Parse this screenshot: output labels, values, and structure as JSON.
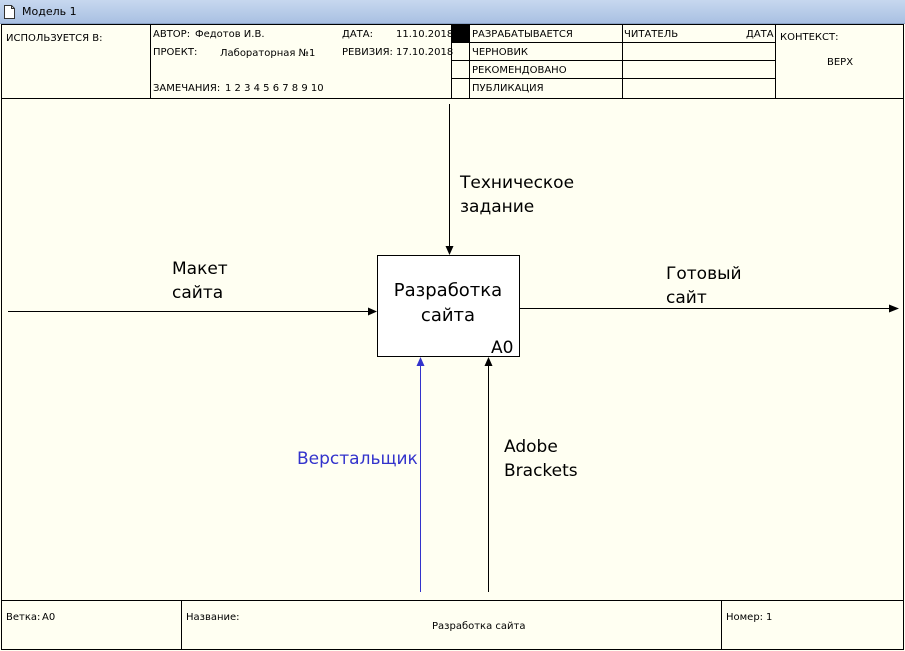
{
  "window": {
    "title": "Модель 1"
  },
  "header": {
    "used_in_label": "ИСПОЛЬЗУЕТСЯ В:",
    "author_label": "АВТОР:",
    "author_value": "Федотов И.В.",
    "date_label": "ДАТА:",
    "date_value": "11.10.2018",
    "project_label": "ПРОЕКТ:",
    "project_value": "Лабораторная №1",
    "revision_label": "РЕВИЗИЯ:",
    "revision_value": "17.10.2018",
    "notes_label": "ЗАМЕЧАНИЯ:",
    "notes_numbers": "1  2  3  4  5  6  7  8  9  10",
    "status": [
      "РАЗРАБАТЫВАЕТСЯ",
      "ЧЕРНОВИК",
      "РЕКОМЕНДОВАНО",
      "ПУБЛИКАЦИЯ"
    ],
    "reader_label": "ЧИТАТЕЛЬ",
    "reader_date_label": "ДАТА",
    "context_label": "КОНТЕКСТ:",
    "context_value": "ВЕРХ"
  },
  "diagram": {
    "activity": {
      "title_line1": "Разработка",
      "title_line2": "сайта",
      "number": "А0"
    },
    "arrows": {
      "control": {
        "line1": "Техническое",
        "line2": "задание"
      },
      "input": {
        "line1": "Макет",
        "line2": "сайта"
      },
      "output": {
        "line1": "Готовый",
        "line2": "сайт"
      },
      "mechanism_1": {
        "line1": "Верстальщик",
        "color": "#3333cc"
      },
      "mechanism_2": {
        "line1": "Adobe",
        "line2": "Brackets"
      }
    }
  },
  "footer": {
    "node_label": "Ветка:",
    "node_value": "А0",
    "name_label": "Название:",
    "name_value": "Разработка сайта",
    "number_label": "Номер:",
    "number_value": "1"
  },
  "colors": {
    "background": "#fffff2",
    "titlebar": "#b4c9e8",
    "mechanism_1": "#3333cc",
    "lines": "#000000"
  }
}
